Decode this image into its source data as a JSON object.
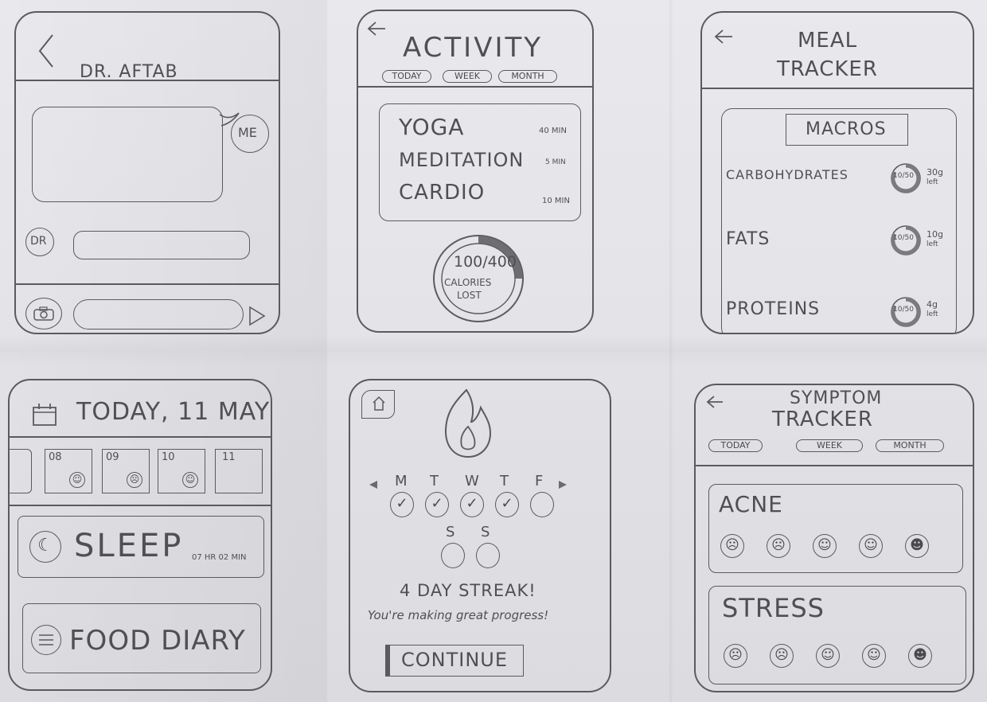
{
  "chat": {
    "title": "DR. AFTAB",
    "me_label": "ME",
    "dr_label": "DR"
  },
  "activity": {
    "title": "ACTIVITY",
    "tabs": [
      "TODAY",
      "WEEK",
      "MONTH"
    ],
    "items": [
      {
        "name": "YOGA",
        "duration": "40 MIN"
      },
      {
        "name": "MEDITATION",
        "duration": "5 MIN"
      },
      {
        "name": "CARDIO",
        "duration": "10 MIN"
      }
    ],
    "calories_value": "100/400",
    "calories_label": "CALORIES",
    "calories_label2": "LOST",
    "calories_progress": 0.25
  },
  "meal": {
    "title_line1": "MEAL",
    "title_line2": "TRACKER",
    "section": "MACROS",
    "macros": [
      {
        "name": "CARBOHYDRATES",
        "ring": "10/50",
        "amount": "30g",
        "left": "left"
      },
      {
        "name": "FATS",
        "ring": "10/50",
        "amount": "10g",
        "left": "left"
      },
      {
        "name": "PROTEINS",
        "ring": "10/50",
        "amount": "4g",
        "left": "left"
      }
    ]
  },
  "diary": {
    "title": "TODAY, 11 MAY",
    "days": [
      "08",
      "09",
      "10",
      "11"
    ],
    "sleep_label": "SLEEP",
    "sleep_time": "07 HR 02 MIN",
    "food_label": "FOOD DIARY"
  },
  "streak": {
    "days_row1": [
      "M",
      "T",
      "W",
      "T",
      "F"
    ],
    "days_row2": [
      "S",
      "S"
    ],
    "checked": [
      true,
      true,
      true,
      true,
      false,
      false,
      false
    ],
    "headline": "4 DAY STREAK!",
    "subtext": "You're making great progress!",
    "button": "CONTINUE"
  },
  "symptom": {
    "title_line1": "SYMPTOM",
    "title_line2": "TRACKER",
    "tabs": [
      "TODAY",
      "WEEK",
      "MONTH"
    ],
    "cards": [
      {
        "label": "ACNE"
      },
      {
        "label": "STRESS"
      }
    ]
  },
  "colors": {
    "ink": "#5a5a5f",
    "paper": "#e6e6ea"
  }
}
